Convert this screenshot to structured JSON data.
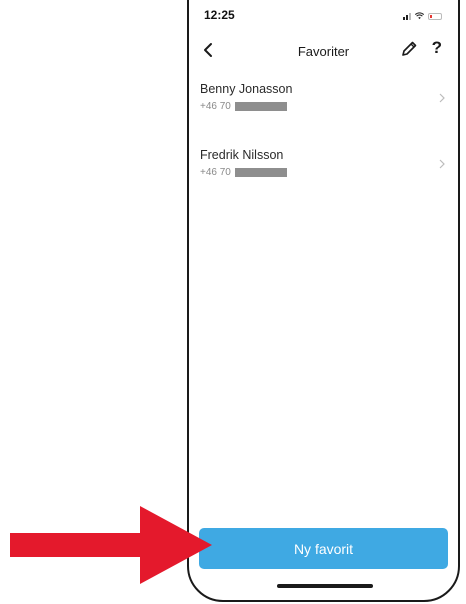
{
  "status_bar": {
    "time": "12:25"
  },
  "header": {
    "title": "Favoriter",
    "back_icon": "chevron-left-icon",
    "edit_icon": "pencil-icon",
    "help_label": "?"
  },
  "favorites": [
    {
      "name": "Benny Jonasson",
      "phone_prefix": "+46 70"
    },
    {
      "name": "Fredrik Nilsson",
      "phone_prefix": "+46 70"
    }
  ],
  "actions": {
    "new_favorite_label": "Ny favorit"
  },
  "colors": {
    "primary_button": "#3fa9e3",
    "annotation_arrow": "#e4192c"
  }
}
